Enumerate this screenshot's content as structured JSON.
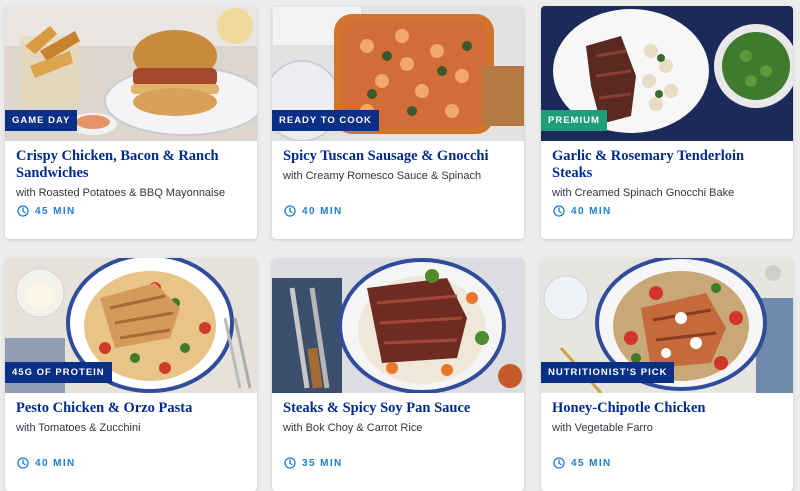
{
  "colors": {
    "title": "#002a8f",
    "badge_navy": "#0a2f86",
    "badge_green": "#1f9e7a",
    "time_blue": "#1c7ed6"
  },
  "icons": {
    "time": "clock-icon"
  },
  "recipes": [
    {
      "badge": "GAME DAY",
      "badge_color": "#0a2f86",
      "title": "Crispy Chicken, Bacon & Ranch Sandwiches",
      "subtitle": "with Roasted Potatoes & BBQ Mayonnaise",
      "time": "45 MIN"
    },
    {
      "badge": "READY TO COOK",
      "badge_color": "#0a2f86",
      "title": "Spicy Tuscan Sausage & Gnocchi",
      "subtitle": "with Creamy Romesco Sauce & Spinach",
      "time": "40 MIN"
    },
    {
      "badge": "PREMIUM",
      "badge_color": "#1f9e7a",
      "title": "Garlic & Rosemary Tenderloin Steaks",
      "subtitle": "with Creamed Spinach Gnocchi Bake",
      "time": "40 MIN"
    },
    {
      "badge": "45G OF PROTEIN",
      "badge_color": "#0a2f86",
      "title": "Pesto Chicken & Orzo Pasta",
      "subtitle": "with Tomatoes & Zucchini",
      "time": "40 MIN"
    },
    {
      "badge": "",
      "badge_color": "#0a2f86",
      "title": "Steaks & Spicy Soy Pan Sauce",
      "subtitle": "with Bok Choy & Carrot Rice",
      "time": "35 MIN"
    },
    {
      "badge": "NUTRITIONIST'S PICK",
      "badge_color": "#0a2f86",
      "title": "Honey-Chipotle Chicken",
      "subtitle": "with Vegetable Farro",
      "time": "45 MIN"
    }
  ]
}
